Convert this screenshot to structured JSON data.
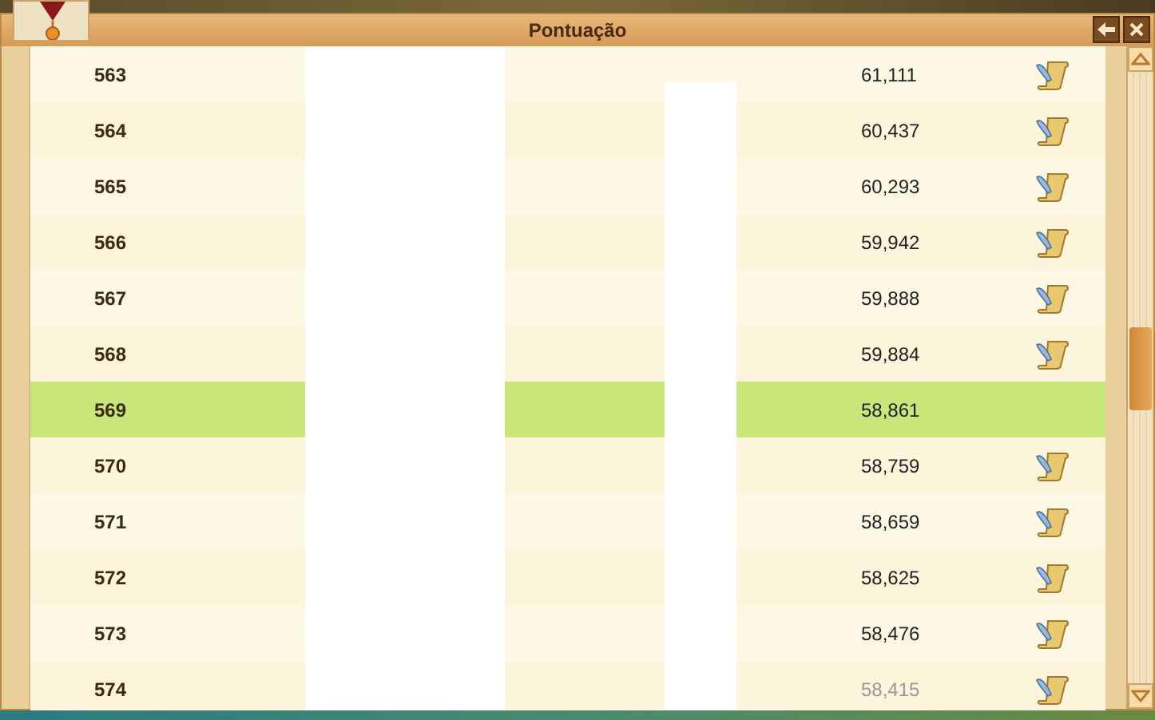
{
  "window": {
    "title": "Pontuação"
  },
  "rows": [
    {
      "rank": "563",
      "score": "61,111",
      "message": true,
      "selected": false,
      "faded": false
    },
    {
      "rank": "564",
      "score": "60,437",
      "message": true,
      "selected": false,
      "faded": false
    },
    {
      "rank": "565",
      "score": "60,293",
      "message": true,
      "selected": false,
      "faded": false
    },
    {
      "rank": "566",
      "score": "59,942",
      "message": true,
      "selected": false,
      "faded": false
    },
    {
      "rank": "567",
      "score": "59,888",
      "message": true,
      "selected": false,
      "faded": false
    },
    {
      "rank": "568",
      "score": "59,884",
      "message": true,
      "selected": false,
      "faded": false
    },
    {
      "rank": "569",
      "score": "58,861",
      "message": false,
      "selected": true,
      "faded": false
    },
    {
      "rank": "570",
      "score": "58,759",
      "message": true,
      "selected": false,
      "faded": false
    },
    {
      "rank": "571",
      "score": "58,659",
      "message": true,
      "selected": false,
      "faded": false
    },
    {
      "rank": "572",
      "score": "58,625",
      "message": true,
      "selected": false,
      "faded": false
    },
    {
      "rank": "573",
      "score": "58,476",
      "message": true,
      "selected": false,
      "faded": false
    },
    {
      "rank": "574",
      "score": "58,415",
      "message": true,
      "selected": false,
      "faded": true
    }
  ]
}
